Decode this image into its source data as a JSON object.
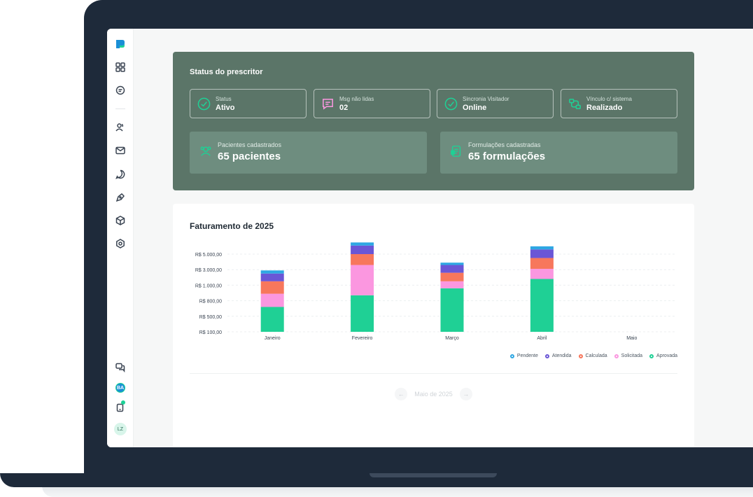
{
  "status": {
    "title": "Status do prescritor",
    "boxes": [
      {
        "label": "Status",
        "value": "Ativo",
        "icon": "check-circle-icon"
      },
      {
        "label": "Msg não lidas",
        "value": "02",
        "icon": "message-icon"
      },
      {
        "label": "Sincronia Visitador",
        "value": "Online",
        "icon": "check-circle-icon"
      },
      {
        "label": "Vínculo c/ sistema",
        "value": "Realizado",
        "icon": "link-icon"
      }
    ],
    "patients": {
      "label": "Pacientes cadastrados",
      "value": "65 pacientes"
    },
    "formulas": {
      "label": "Formulações cadastradas",
      "value": "65 formulações"
    }
  },
  "revenue": {
    "title": "Faturamento de 2025",
    "pager_label": "Maio de 2025",
    "prev": "←",
    "next": "→"
  },
  "sidebar": {
    "avatar_ba": "BA",
    "avatar_lz": "LZ"
  },
  "chart_data": {
    "type": "bar",
    "stacked": true,
    "categories": [
      "Janeiro",
      "Fevereiro",
      "Março",
      "Abril",
      "Maio"
    ],
    "y_tick_labels": [
      "R$ 100,00",
      "R$ 500,00",
      "R$ 800,00",
      "R$ 1.000,00",
      "R$ 3.000,00",
      "R$ 5.000,00"
    ],
    "legend_placement": "bottom-right",
    "series": [
      {
        "name": "Aprovada",
        "color": "#1fd095",
        "values": [
          1.6,
          2.35,
          2.8,
          3.4,
          0
        ]
      },
      {
        "name": "Solicitada",
        "color": "#fb97e0",
        "values": [
          0.85,
          1.95,
          0.45,
          0.65,
          0
        ]
      },
      {
        "name": "Calculada",
        "color": "#f7775c",
        "values": [
          0.8,
          0.7,
          0.55,
          0.7,
          0
        ]
      },
      {
        "name": "Atendida",
        "color": "#6a56d6",
        "values": [
          0.5,
          0.55,
          0.5,
          0.55,
          0
        ]
      },
      {
        "name": "Pendente",
        "color": "#2ea7e3",
        "values": [
          0.2,
          0.2,
          0.15,
          0.2,
          0
        ]
      }
    ]
  }
}
